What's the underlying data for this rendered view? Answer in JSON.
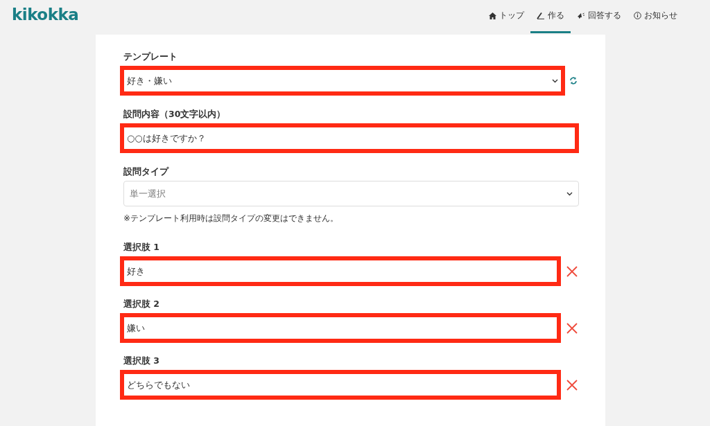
{
  "header": {
    "logo": "kikokka",
    "nav": [
      {
        "label": "トップ",
        "selected": false
      },
      {
        "label": "作る",
        "selected": true
      },
      {
        "label": "回答する",
        "selected": false
      },
      {
        "label": "お知らせ",
        "selected": false
      }
    ]
  },
  "form": {
    "template": {
      "label": "テンプレート",
      "value": "好き・嫌い",
      "highlighted": true
    },
    "question": {
      "label": "設問内容（30文字以内）",
      "value": "○○は好きですか？",
      "highlighted": true
    },
    "question_type": {
      "label": "設問タイプ",
      "value": "単一選択",
      "disabled": true,
      "note": "※テンプレート利用時は設問タイプの変更はできません。"
    },
    "choices": [
      {
        "label": "選択肢 1",
        "value": "好き",
        "highlighted": true
      },
      {
        "label": "選択肢 2",
        "value": "嫌い",
        "highlighted": true
      },
      {
        "label": "選択肢 3",
        "value": "どちらでもない",
        "highlighted": true
      }
    ]
  }
}
